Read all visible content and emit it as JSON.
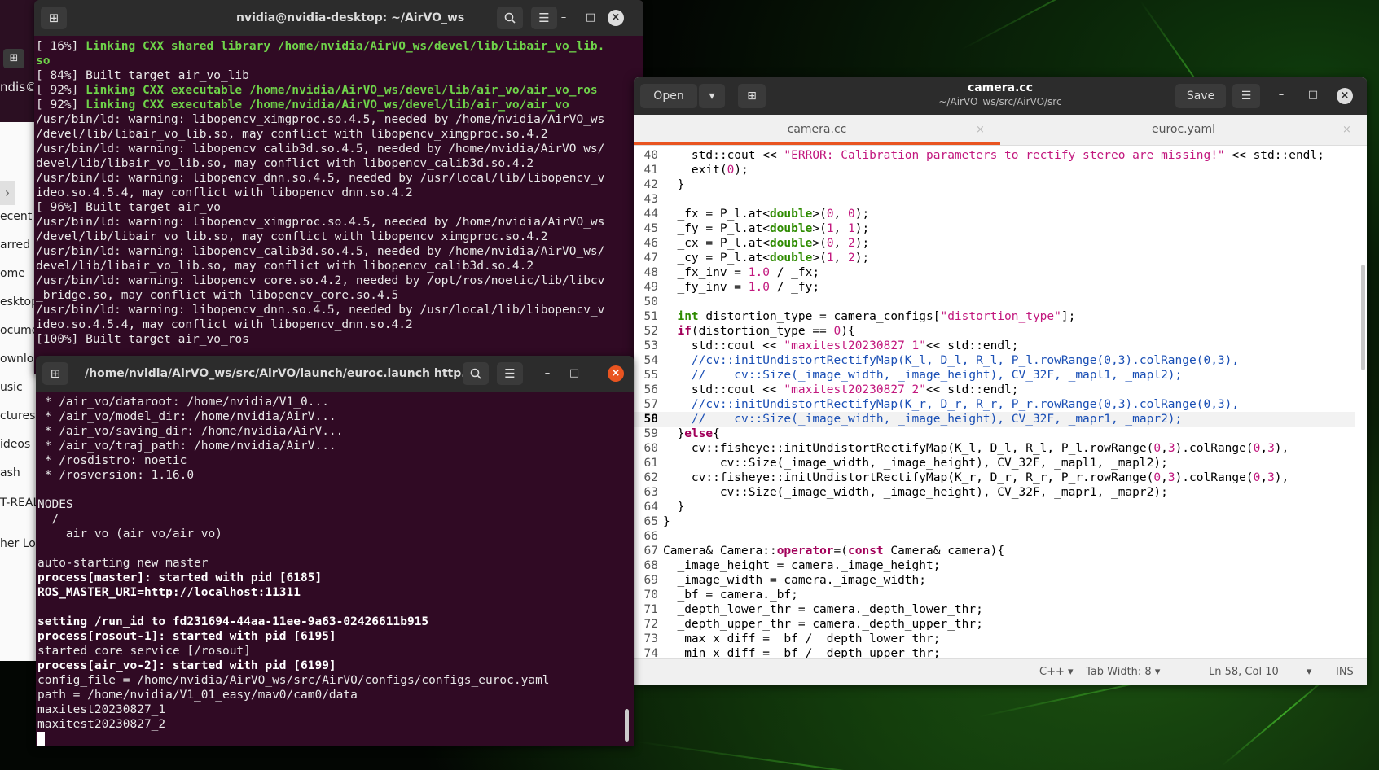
{
  "files": {
    "header_label": "ndis©",
    "sidebar_items": [
      "ecent",
      "arred",
      "ome",
      "esktop",
      "ocume",
      "ownloa",
      "usic",
      "ctures",
      "ideos",
      "ash",
      "T-REAL",
      "her Lo"
    ]
  },
  "terminal_build": {
    "title": "nvidia@nvidia-desktop: ~/AirVO_ws",
    "lines": [
      {
        "t": "[ 16%] ",
        "g": "Linking CXX shared library /home/nvidia/AirVO_ws/devel/lib/libair_vo_lib."
      },
      {
        "g": "so"
      },
      {
        "t": "[ 84%] Built target air_vo_lib"
      },
      {
        "t": "[ 92%] ",
        "g": "Linking CXX executable /home/nvidia/AirVO_ws/devel/lib/air_vo/air_vo_ros"
      },
      {
        "t": "[ 92%] ",
        "g": "Linking CXX executable /home/nvidia/AirVO_ws/devel/lib/air_vo/air_vo"
      },
      {
        "t": "/usr/bin/ld: warning: libopencv_ximgproc.so.4.5, needed by /home/nvidia/AirVO_ws"
      },
      {
        "t": "/devel/lib/libair_vo_lib.so, may conflict with libopencv_ximgproc.so.4.2"
      },
      {
        "t": "/usr/bin/ld: warning: libopencv_calib3d.so.4.5, needed by /home/nvidia/AirVO_ws/"
      },
      {
        "t": "devel/lib/libair_vo_lib.so, may conflict with libopencv_calib3d.so.4.2"
      },
      {
        "t": "/usr/bin/ld: warning: libopencv_dnn.so.4.5, needed by /usr/local/lib/libopencv_v"
      },
      {
        "t": "ideo.so.4.5.4, may conflict with libopencv_dnn.so.4.2"
      },
      {
        "t": "[ 96%] Built target air_vo"
      },
      {
        "t": "/usr/bin/ld: warning: libopencv_ximgproc.so.4.5, needed by /home/nvidia/AirVO_ws"
      },
      {
        "t": "/devel/lib/libair_vo_lib.so, may conflict with libopencv_ximgproc.so.4.2"
      },
      {
        "t": "/usr/bin/ld: warning: libopencv_calib3d.so.4.5, needed by /home/nvidia/AirVO_ws/"
      },
      {
        "t": "devel/lib/libair_vo_lib.so, may conflict with libopencv_calib3d.so.4.2"
      },
      {
        "t": "/usr/bin/ld: warning: libopencv_core.so.4.2, needed by /opt/ros/noetic/lib/libcv"
      },
      {
        "t": "_bridge.so, may conflict with libopencv_core.so.4.5"
      },
      {
        "t": "/usr/bin/ld: warning: libopencv_dnn.so.4.5, needed by /usr/local/lib/libopencv_v"
      },
      {
        "t": "ideo.so.4.5.4, may conflict with libopencv_dnn.so.4.2"
      },
      {
        "t": "[100%] Built target air_vo_ros"
      }
    ]
  },
  "terminal_launch": {
    "title": "/home/nvidia/AirVO_ws/src/AirVO/launch/euroc.launch http...",
    "lines": [
      {
        "t": " * /air_vo/dataroot: /home/nvidia/V1_0..."
      },
      {
        "t": " * /air_vo/model_dir: /home/nvidia/AirV..."
      },
      {
        "t": " * /air_vo/saving_dir: /home/nvidia/AirV..."
      },
      {
        "t": " * /air_vo/traj_path: /home/nvidia/AirV..."
      },
      {
        "t": " * /rosdistro: noetic"
      },
      {
        "t": " * /rosversion: 1.16.0"
      },
      {
        "t": ""
      },
      {
        "t": "NODES"
      },
      {
        "t": "  /"
      },
      {
        "t": "    air_vo (air_vo/air_vo)"
      },
      {
        "t": ""
      },
      {
        "t": "auto-starting new master"
      },
      {
        "b": "process[master]: started with pid [6185]"
      },
      {
        "b": "ROS_MASTER_URI=http://localhost:11311"
      },
      {
        "t": ""
      },
      {
        "b": "setting /run_id to fd231694-44aa-11ee-9a63-02426611b915"
      },
      {
        "b": "process[rosout-1]: started with pid [6195]"
      },
      {
        "t": "started core service [/rosout]"
      },
      {
        "b": "process[air_vo-2]: started with pid [6199]"
      },
      {
        "t": "config_file = /home/nvidia/AirVO_ws/src/AirVO/configs/configs_euroc.yaml"
      },
      {
        "t": "path = /home/nvidia/V1_01_easy/mav0/cam0/data"
      },
      {
        "t": "maxitest20230827_1"
      },
      {
        "t": "maxitest20230827_2"
      }
    ]
  },
  "gedit": {
    "open_label": "Open",
    "save_label": "Save",
    "title": "camera.cc",
    "subtitle": "~/AirVO_ws/src/AirVO/src",
    "tabs": [
      {
        "label": "camera.cc"
      },
      {
        "label": "euroc.yaml"
      }
    ],
    "status": {
      "lang": "C++",
      "tab_width": "Tab Width: 8",
      "position": "Ln 58, Col 10",
      "mode": "INS"
    },
    "current_line": 58,
    "code": [
      {
        "n": "40",
        "s": [
          [
            "",
            "    std::cout << "
          ],
          [
            "st",
            "\"ERROR: Calibration parameters to rectify stereo are missing!\""
          ],
          [
            "",
            " << std::endl;"
          ]
        ]
      },
      {
        "n": "41",
        "s": [
          [
            "",
            "    exit("
          ],
          [
            "nu",
            "0"
          ],
          [
            "",
            "); "
          ]
        ]
      },
      {
        "n": "42",
        "s": [
          [
            "",
            "  }"
          ]
        ]
      },
      {
        "n": "43",
        "s": [
          [
            "",
            ""
          ]
        ]
      },
      {
        "n": "44",
        "s": [
          [
            "",
            "  _fx = P_l.at<"
          ],
          [
            "ty",
            "double"
          ],
          [
            "",
            ">("
          ],
          [
            "nu",
            "0"
          ],
          [
            "",
            ", "
          ],
          [
            "nu",
            "0"
          ],
          [
            "",
            ");"
          ]
        ]
      },
      {
        "n": "45",
        "s": [
          [
            "",
            "  _fy = P_l.at<"
          ],
          [
            "ty",
            "double"
          ],
          [
            "",
            ">("
          ],
          [
            "nu",
            "1"
          ],
          [
            "",
            ", "
          ],
          [
            "nu",
            "1"
          ],
          [
            "",
            ");"
          ]
        ]
      },
      {
        "n": "46",
        "s": [
          [
            "",
            "  _cx = P_l.at<"
          ],
          [
            "ty",
            "double"
          ],
          [
            "",
            ">("
          ],
          [
            "nu",
            "0"
          ],
          [
            "",
            ", "
          ],
          [
            "nu",
            "2"
          ],
          [
            "",
            ");"
          ]
        ]
      },
      {
        "n": "47",
        "s": [
          [
            "",
            "  _cy = P_l.at<"
          ],
          [
            "ty",
            "double"
          ],
          [
            "",
            ">("
          ],
          [
            "nu",
            "1"
          ],
          [
            "",
            ", "
          ],
          [
            "nu",
            "2"
          ],
          [
            "",
            ");"
          ]
        ]
      },
      {
        "n": "48",
        "s": [
          [
            "",
            "  _fx_inv = "
          ],
          [
            "nu",
            "1.0"
          ],
          [
            "",
            " / _fx;"
          ]
        ]
      },
      {
        "n": "49",
        "s": [
          [
            "",
            "  _fy_inv = "
          ],
          [
            "nu",
            "1.0"
          ],
          [
            "",
            " / _fy;"
          ]
        ]
      },
      {
        "n": "50",
        "s": [
          [
            "",
            ""
          ]
        ]
      },
      {
        "n": "51",
        "s": [
          [
            "ty",
            "  int"
          ],
          [
            "",
            " distortion_type = camera_configs["
          ],
          [
            "st",
            "\"distortion_type\""
          ],
          [
            "",
            "];"
          ]
        ]
      },
      {
        "n": "52",
        "s": [
          [
            "kw",
            "  if"
          ],
          [
            "",
            "(distortion_type == "
          ],
          [
            "nu",
            "0"
          ],
          [
            "",
            "){"
          ]
        ]
      },
      {
        "n": "53",
        "s": [
          [
            "",
            "    std::cout << "
          ],
          [
            "st",
            "\"maxitest20230827_1\""
          ],
          [
            "",
            "<< std::endl;"
          ]
        ]
      },
      {
        "n": "54",
        "s": [
          [
            "cm",
            "    //cv::initUndistortRectifyMap(K_l, D_l, R_l, P_l.rowRange(0,3).colRange(0,3),"
          ]
        ]
      },
      {
        "n": "55",
        "s": [
          [
            "cm",
            "    //    cv::Size(_image_width, _image_height), CV_32F, _mapl1, _mapl2);"
          ]
        ]
      },
      {
        "n": "56",
        "s": [
          [
            "",
            "    std::cout << "
          ],
          [
            "st",
            "\"maxitest20230827_2\""
          ],
          [
            "",
            "<< std::endl;"
          ]
        ]
      },
      {
        "n": "57",
        "s": [
          [
            "cm",
            "    //cv::initUndistortRectifyMap(K_r, D_r, R_r, P_r.rowRange(0,3).colRange(0,3),"
          ]
        ]
      },
      {
        "n": "58",
        "s": [
          [
            "cm",
            "    //    cv::Size(_image_width, _image_height), CV_32F, _mapr1, _mapr2);"
          ]
        ]
      },
      {
        "n": "59",
        "s": [
          [
            "",
            "  }"
          ],
          [
            "kw",
            "else"
          ],
          [
            "",
            "{"
          ]
        ]
      },
      {
        "n": "60",
        "s": [
          [
            "",
            "    cv::fisheye::initUndistortRectifyMap(K_l, D_l, R_l, P_l.rowRange("
          ],
          [
            "nu",
            "0"
          ],
          [
            "",
            ","
          ],
          [
            "nu",
            "3"
          ],
          [
            "",
            ").colRange("
          ],
          [
            "nu",
            "0"
          ],
          [
            "",
            ","
          ],
          [
            "nu",
            "3"
          ],
          [
            "",
            "),"
          ]
        ]
      },
      {
        "n": "61",
        "s": [
          [
            "",
            "        cv::Size(_image_width, _image_height), CV_32F, _mapl1, _mapl2);"
          ]
        ]
      },
      {
        "n": "62",
        "s": [
          [
            "",
            "    cv::fisheye::initUndistortRectifyMap(K_r, D_r, R_r, P_r.rowRange("
          ],
          [
            "nu",
            "0"
          ],
          [
            "",
            ","
          ],
          [
            "nu",
            "3"
          ],
          [
            "",
            ").colRange("
          ],
          [
            "nu",
            "0"
          ],
          [
            "",
            ","
          ],
          [
            "nu",
            "3"
          ],
          [
            "",
            "),"
          ]
        ]
      },
      {
        "n": "63",
        "s": [
          [
            "",
            "        cv::Size(_image_width, _image_height), CV_32F, _mapr1, _mapr2);"
          ]
        ]
      },
      {
        "n": "64",
        "s": [
          [
            "",
            "  }"
          ]
        ]
      },
      {
        "n": "65",
        "s": [
          [
            "",
            "}"
          ]
        ]
      },
      {
        "n": "66",
        "s": [
          [
            "",
            ""
          ]
        ]
      },
      {
        "n": "67",
        "s": [
          [
            "",
            "Camera& Camera::"
          ],
          [
            "kw",
            "operator"
          ],
          [
            "",
            "=("
          ],
          [
            "kw",
            "const"
          ],
          [
            "",
            " Camera& camera){"
          ]
        ]
      },
      {
        "n": "68",
        "s": [
          [
            "",
            "  _image_height = camera._image_height;"
          ]
        ]
      },
      {
        "n": "69",
        "s": [
          [
            "",
            "  _image_width = camera._image_width;"
          ]
        ]
      },
      {
        "n": "70",
        "s": [
          [
            "",
            "  _bf = camera._bf;"
          ]
        ]
      },
      {
        "n": "71",
        "s": [
          [
            "",
            "  _depth_lower_thr = camera._depth_lower_thr;"
          ]
        ]
      },
      {
        "n": "72",
        "s": [
          [
            "",
            "  _depth_upper_thr = camera._depth_upper_thr;"
          ]
        ]
      },
      {
        "n": "73",
        "s": [
          [
            "",
            "  _max_x_diff = _bf / _depth_lower_thr;"
          ]
        ]
      },
      {
        "n": "74",
        "s": [
          [
            "",
            "  _min_x_diff = _bf / _depth_upper_thr;"
          ]
        ]
      }
    ]
  }
}
